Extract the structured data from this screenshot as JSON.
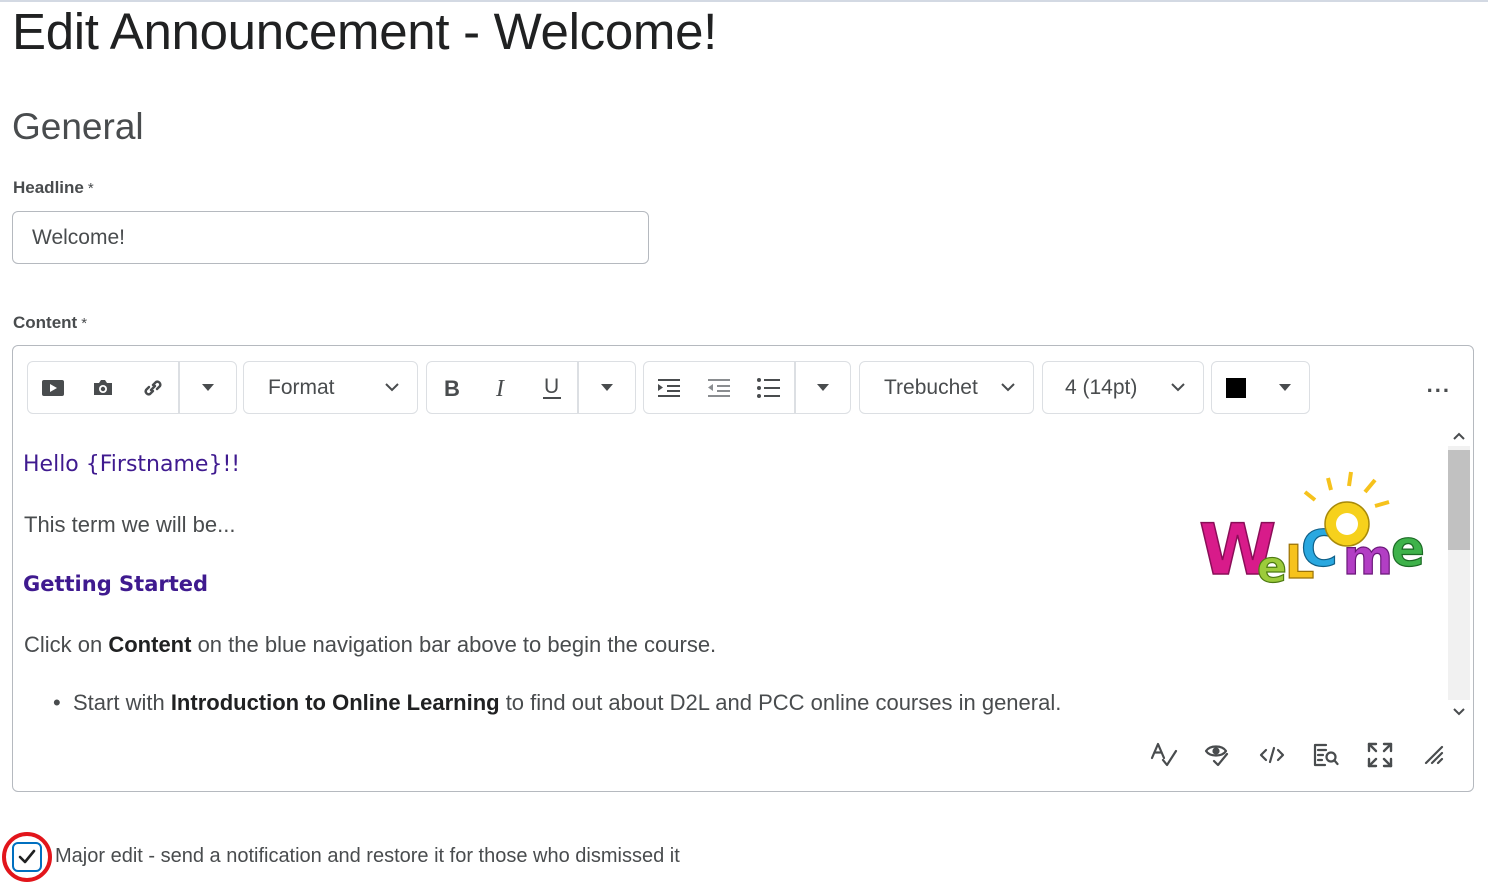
{
  "page": {
    "title": "Edit Announcement - Welcome!"
  },
  "general": {
    "section_title": "General",
    "headline_label": "Headline",
    "headline_value": "Welcome!",
    "content_label": "Content",
    "required_mark": "*"
  },
  "toolbar": {
    "format_label": "Format",
    "font_label": "Trebuchet",
    "size_label": "4 (14pt)",
    "color_value": "#000000",
    "more_label": "..."
  },
  "content": {
    "hello": "Hello {Firstname}!!",
    "term": "This term we will be...",
    "getting_started": "Getting Started",
    "click_prefix": "Click on ",
    "click_bold": "Content",
    "click_suffix": " on the blue navigation bar above to begin the course.",
    "bullet_prefix": "Start with ",
    "bullet_bold": "Introduction to Online Learning",
    "bullet_suffix": " to find out about D2L and PCC online courses in general.",
    "image_alt": "Welcome"
  },
  "options": {
    "major_edit_label": "Major edit - send a notification and restore it for those who dismissed it",
    "major_edit_checked": true
  },
  "colors": {
    "accent": "#006fbf",
    "heading_purple": "#3f1a8f",
    "highlight_ring": "#e2151b"
  }
}
